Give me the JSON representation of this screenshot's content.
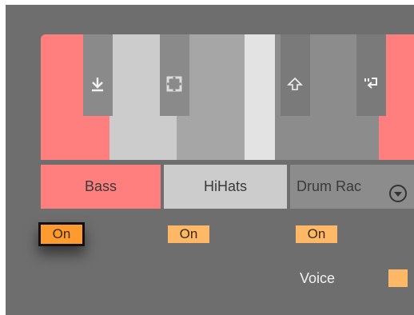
{
  "rack": {
    "chains": [
      {
        "label": "Bass",
        "on_label": "On",
        "on_selected": true,
        "color": "#ff7f7f"
      },
      {
        "label": "HiHats",
        "on_label": "On",
        "on_selected": false,
        "color": "#cccccc"
      },
      {
        "label": "Drum Rac",
        "on_label": "On",
        "on_selected": false,
        "color": "#8c8c8c"
      }
    ],
    "chain_menu_icon": "circle-chevron-down-icon",
    "key_icons": [
      "download-arrow-icon",
      "split-square-icon",
      "up-arrow-outline-icon",
      "return-arrow-icon"
    ],
    "voice": {
      "label": "Voice",
      "color": "#ffb866"
    }
  },
  "colors": {
    "panel_bg": "#6e6e6e",
    "accent_red": "#ff7f7f",
    "light_gray": "#cccccc",
    "lighter_gray": "#e3e3e3",
    "mid_gray": "#a6a6a6",
    "on_orange": "#ff9a2e",
    "on_light_orange": "#ffb866"
  }
}
